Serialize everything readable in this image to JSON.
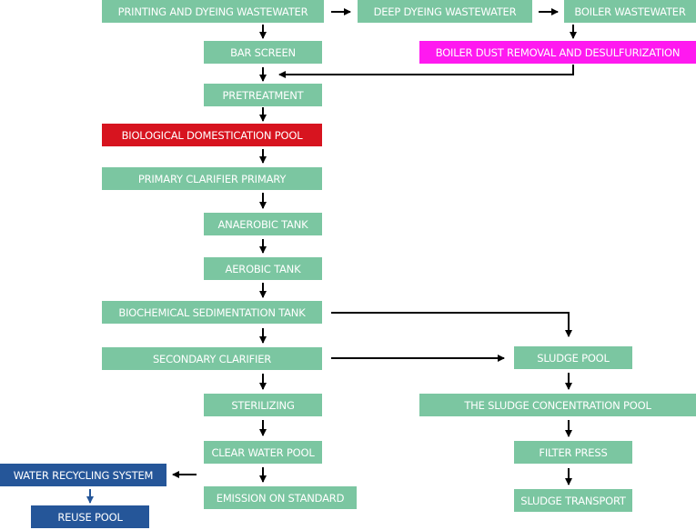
{
  "diagram": {
    "title": "",
    "colors": {
      "process": "#7bc6a1",
      "highlight_red": "#d7141f",
      "highlight_magenta": "#ff19f0",
      "recycling_blue": "#255699",
      "arrow": "#000000",
      "recycling_arrow": "#255699"
    },
    "nodes": {
      "printing_dyeing_wastewater": "PRINTING AND DYEING WASTEWATER",
      "deep_dyeing_wastewater": "DEEP DYEING WASTEWATER",
      "boiler_wastewater": "BOILER WASTEWATER",
      "boiler_dust_removal": "BOILER DUST REMOVAL AND DESULFURIZATION",
      "bar_screen": "BAR SCREEN",
      "pretreatment": "PRETREATMENT",
      "biological_domestication_pool": "BIOLOGICAL DOMESTICATION POOL",
      "primary_clarifier": "PRIMARY CLARIFIER PRIMARY",
      "anaerobic_tank": "ANAEROBIC TANK",
      "aerobic_tank": "AEROBIC TANK",
      "biochemical_sedimentation_tank": "BIOCHEMICAL SEDIMENTATION TANK",
      "secondary_clarifier": "SECONDARY CLARIFIER",
      "sterilizing": "STERILIZING",
      "clear_water_pool": "CLEAR WATER POOL",
      "emission_on_standard": "EMISSION ON STANDARD",
      "water_recycling_system": "WATER RECYCLING SYSTEM",
      "reuse_pool": "REUSE POOL",
      "sludge_pool": "SLUDGE POOL",
      "sludge_concentration_pool": "THE SLUDGE CONCENTRATION POOL",
      "filter_press": "FILTER PRESS",
      "sludge_transport": "SLUDGE TRANSPORT"
    },
    "edges": [
      [
        "printing_dyeing_wastewater",
        "deep_dyeing_wastewater"
      ],
      [
        "deep_dyeing_wastewater",
        "boiler_wastewater"
      ],
      [
        "boiler_wastewater",
        "boiler_dust_removal"
      ],
      [
        "boiler_dust_removal",
        "pretreatment"
      ],
      [
        "printing_dyeing_wastewater",
        "bar_screen"
      ],
      [
        "bar_screen",
        "pretreatment"
      ],
      [
        "pretreatment",
        "biological_domestication_pool"
      ],
      [
        "biological_domestication_pool",
        "primary_clarifier"
      ],
      [
        "primary_clarifier",
        "anaerobic_tank"
      ],
      [
        "anaerobic_tank",
        "aerobic_tank"
      ],
      [
        "aerobic_tank",
        "biochemical_sedimentation_tank"
      ],
      [
        "biochemical_sedimentation_tank",
        "secondary_clarifier"
      ],
      [
        "biochemical_sedimentation_tank",
        "sludge_pool"
      ],
      [
        "secondary_clarifier",
        "sludge_pool"
      ],
      [
        "secondary_clarifier",
        "sterilizing"
      ],
      [
        "sterilizing",
        "clear_water_pool"
      ],
      [
        "clear_water_pool",
        "emission_on_standard"
      ],
      [
        "clear_water_pool",
        "water_recycling_system"
      ],
      [
        "water_recycling_system",
        "reuse_pool"
      ],
      [
        "sludge_pool",
        "sludge_concentration_pool"
      ],
      [
        "sludge_concentration_pool",
        "filter_press"
      ],
      [
        "filter_press",
        "sludge_transport"
      ]
    ]
  }
}
